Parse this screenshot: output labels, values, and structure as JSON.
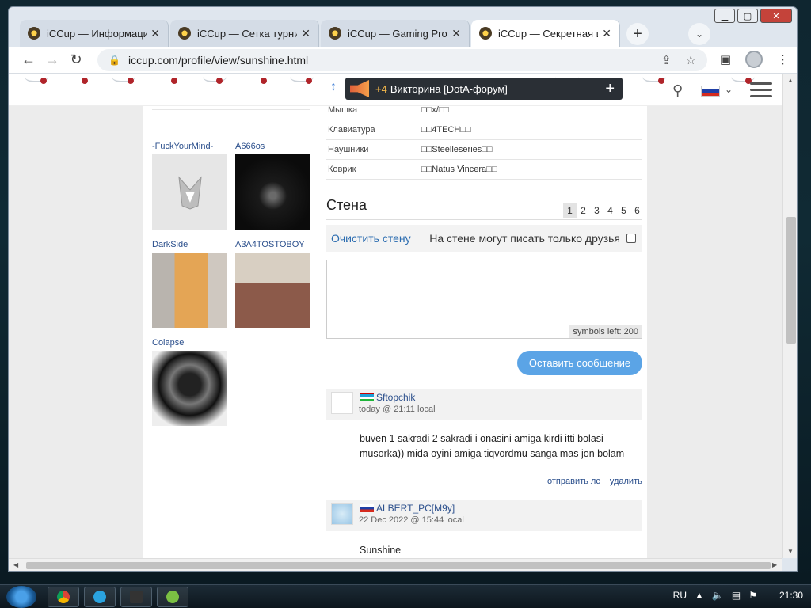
{
  "browser": {
    "tabs": [
      {
        "title": "iCCup — Информация"
      },
      {
        "title": "iCCup — Сетка турнира"
      },
      {
        "title": "iCCup — Gaming Profile"
      },
      {
        "title": "iCCup — Секретная ин",
        "active": true
      }
    ],
    "url": "iccup.com/profile/view/sunshine.html"
  },
  "header": {
    "quiz_count": "+4",
    "quiz_text": "Викторина [DotA-форум]",
    "quiz_plus": "+"
  },
  "friends": [
    {
      "name": "-FuckYourMind-"
    },
    {
      "name": "A666os"
    },
    {
      "name": "DarkSide"
    },
    {
      "name": "A3A4TOSTOBOY"
    },
    {
      "name": "Colapse"
    }
  ],
  "hardware": [
    {
      "key": "Мышка",
      "value": "□□x/□□"
    },
    {
      "key": "Клавиатура",
      "value": "□□4TECH□□"
    },
    {
      "key": "Наушники",
      "value": "□□Steelleseries□□"
    },
    {
      "key": "Коврик",
      "value": "□□Natus Vincera□□"
    }
  ],
  "wall": {
    "title": "Стена",
    "pages": [
      "1",
      "2",
      "3",
      "4",
      "5",
      "6"
    ],
    "current_page": "1",
    "clear_label": "Очистить стену",
    "friends_only_label": "На стене могут писать только друзья",
    "symbols_left": "symbols left: 200",
    "submit_label": "Оставить сообщение"
  },
  "posts": [
    {
      "author": "Sftopchik",
      "time": "today @ 21:11 local",
      "body_lines": [
        "buven 1 sakradi 2 sakradi i onasini amiga kirdi itti bolasi",
        "musorka)) mida oyini amiga tiqvordmu sanga mas jon bolam"
      ],
      "actions": [
        "отправить лс",
        "удалить"
      ]
    },
    {
      "author": "ALBERT_PC[M9y]",
      "time": "22 Dec 2022 @ 15:44 local",
      "body_lines": [
        "Sunshine"
      ]
    }
  ],
  "taskbar": {
    "lang": "RU",
    "clock": "21:30"
  },
  "colors": {
    "link": "#2b4f8c",
    "accent_button": "#5ba4e6",
    "quiz_banner": "#2a2f35"
  }
}
